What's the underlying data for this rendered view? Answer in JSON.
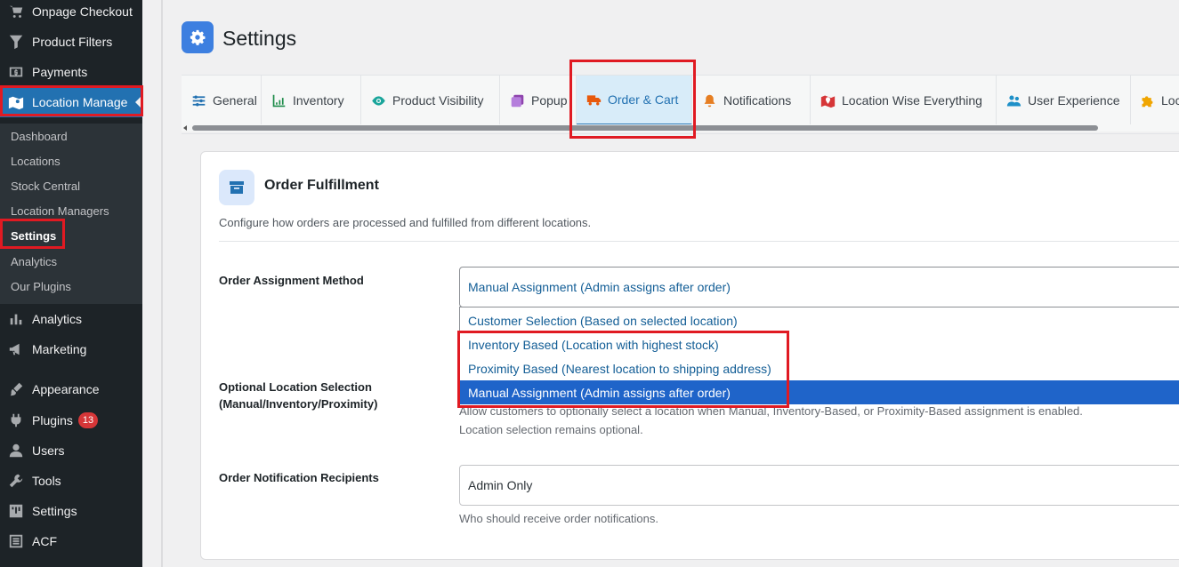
{
  "sidebar": {
    "menu": [
      {
        "label": "Onpage Checkout",
        "icon": "cart-icon"
      },
      {
        "label": "Product Filters",
        "icon": "filter-icon"
      },
      {
        "label": "Payments",
        "icon": "payments-icon"
      },
      {
        "label": "Location Manage",
        "icon": "map-icon"
      },
      {
        "label": "Analytics",
        "icon": "bar-chart-icon"
      },
      {
        "label": "Marketing",
        "icon": "megaphone-icon"
      },
      {
        "label": "Appearance",
        "icon": "paintbrush-icon"
      },
      {
        "label": "Plugins",
        "icon": "plugin-icon",
        "badge": "13"
      },
      {
        "label": "Users",
        "icon": "users-icon"
      },
      {
        "label": "Tools",
        "icon": "wrench-icon"
      },
      {
        "label": "Settings",
        "icon": "sliders-icon"
      },
      {
        "label": "ACF",
        "icon": "acf-icon"
      }
    ],
    "submenu": [
      "Dashboard",
      "Locations",
      "Stock Central",
      "Location Managers",
      "Settings",
      "Analytics",
      "Our Plugins"
    ]
  },
  "page": {
    "title": "Settings"
  },
  "tabs": [
    {
      "label": "General",
      "icon": "sliders-icon",
      "color": "#2271b1"
    },
    {
      "label": "Inventory",
      "icon": "chart-icon",
      "color": "#1e8c4a"
    },
    {
      "label": "Product Visibility",
      "icon": "eye-icon",
      "color": "#1aa59b"
    },
    {
      "label": "Popup",
      "icon": "window-icon",
      "color": "#8e44ad"
    },
    {
      "label": "Order & Cart",
      "icon": "truck-icon",
      "color": "#e8590c"
    },
    {
      "label": "Notifications",
      "icon": "bell-icon",
      "color": "#e67e22"
    },
    {
      "label": "Location Wise Everything",
      "icon": "map-marker-icon",
      "color": "#d63638"
    },
    {
      "label": "User Experience",
      "icon": "users-icon",
      "color": "#1e90c8"
    },
    {
      "label": "Loc",
      "icon": "puzzle-icon",
      "color": "#f0a500"
    }
  ],
  "card": {
    "title": "Order Fulfillment",
    "description": "Configure how orders are processed and fulfilled from different locations."
  },
  "fields": {
    "assignment": {
      "label": "Order Assignment Method",
      "value": "Manual Assignment (Admin assigns after order)",
      "options": [
        "Customer Selection (Based on selected location)",
        "Inventory Based (Location with highest stock)",
        "Proximity Based (Nearest location to shipping address)",
        "Manual Assignment (Admin assigns after order)"
      ]
    },
    "optional": {
      "label_line1": "Optional Location Selection",
      "label_line2": "(Manual/Inventory/Proximity)",
      "help_line1": "Allow customers to optionally select a location when Manual, Inventory-Based, or Proximity-Based assignment is enabled.",
      "help_line2": "Location selection remains optional."
    },
    "recipients": {
      "label": "Order Notification Recipients",
      "value": "Admin Only",
      "help": "Who should receive order notifications."
    }
  },
  "colors": {
    "accent": "#2271b1",
    "highlight": "#e01a22",
    "selected_option": "#1f64c9"
  }
}
